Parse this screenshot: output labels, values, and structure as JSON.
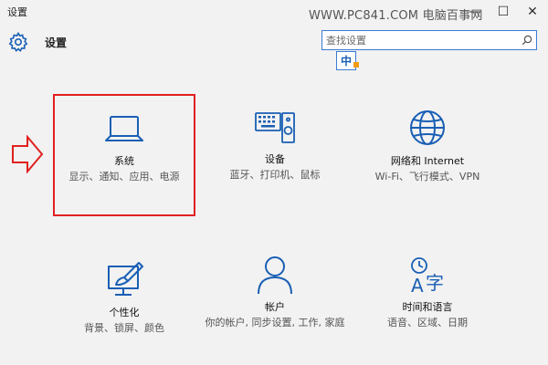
{
  "window": {
    "title": "设置",
    "watermark": "WWW.PC841.COM 电脑百事网",
    "minimize_glyph": "—",
    "maximize_glyph": "☐",
    "close_glyph": "✕"
  },
  "header": {
    "title": "设置",
    "icon": "gear-icon"
  },
  "search": {
    "placeholder": "查找设置",
    "value": "",
    "icon": "search-icon"
  },
  "ime": {
    "label": "中"
  },
  "tiles": [
    {
      "label": "系统",
      "desc": "显示、通知、应用、电源",
      "icon": "laptop-icon"
    },
    {
      "label": "设备",
      "desc": "蓝牙、打印机、鼠标",
      "icon": "keyboard-speaker-icon"
    },
    {
      "label": "网络和 Internet",
      "desc": "Wi-Fi、飞行模式、VPN",
      "icon": "globe-icon"
    },
    {
      "label": "个性化",
      "desc": "背景、锁屏、颜色",
      "icon": "paint-brush-icon"
    },
    {
      "label": "帐户",
      "desc": "你的帐户, 同步设置, 工作, 家庭",
      "icon": "person-icon"
    },
    {
      "label": "时间和语言",
      "desc": "语音、区域、日期",
      "icon": "time-language-icon"
    }
  ],
  "colors": {
    "accent": "#1a5fb4",
    "highlight": "#e02020",
    "background": "#f2f2f2"
  }
}
